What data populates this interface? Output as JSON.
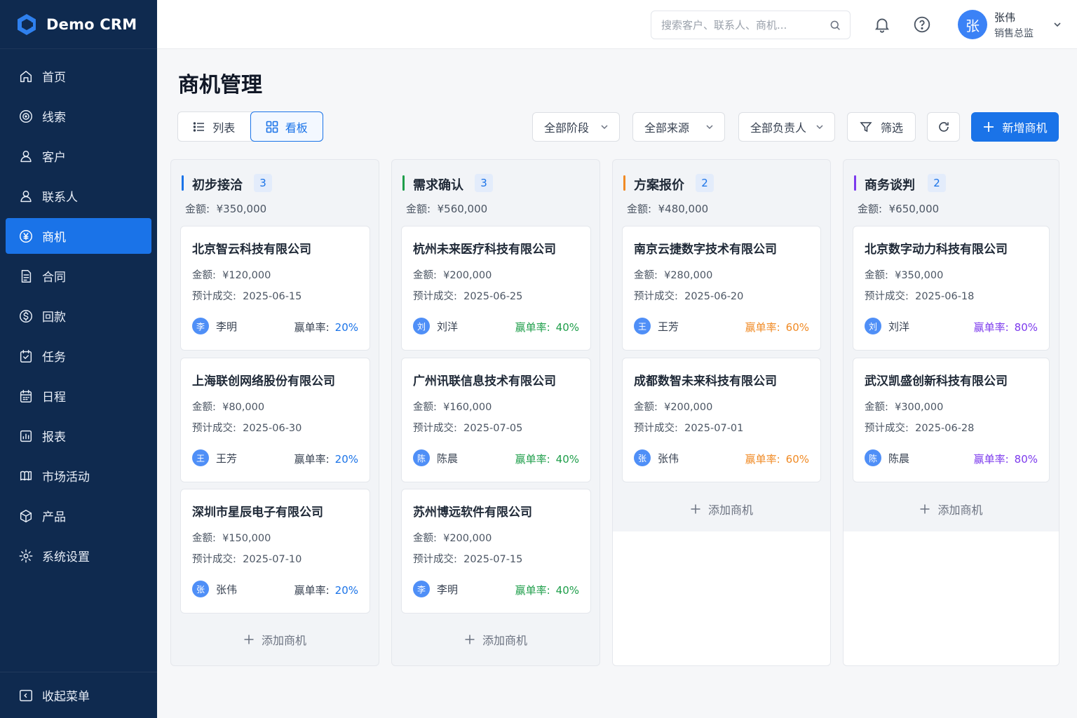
{
  "app": {
    "brand": "Demo CRM"
  },
  "sidebar": {
    "items": [
      {
        "label": "首页",
        "icon": "home-icon"
      },
      {
        "label": "线索",
        "icon": "lead-icon"
      },
      {
        "label": "客户",
        "icon": "customer-icon"
      },
      {
        "label": "联系人",
        "icon": "contact-icon"
      },
      {
        "label": "商机",
        "icon": "opportunity-icon",
        "active": true
      },
      {
        "label": "合同",
        "icon": "contract-icon"
      },
      {
        "label": "回款",
        "icon": "payment-icon"
      },
      {
        "label": "任务",
        "icon": "task-icon"
      },
      {
        "label": "日程",
        "icon": "calendar-icon"
      },
      {
        "label": "报表",
        "icon": "report-icon"
      },
      {
        "label": "市场活动",
        "icon": "campaign-icon"
      },
      {
        "label": "产品",
        "icon": "product-icon"
      },
      {
        "label": "系统设置",
        "icon": "settings-icon"
      }
    ],
    "collapse_label": "收起菜单"
  },
  "topbar": {
    "search_placeholder": "搜索客户、联系人、商机...",
    "user": {
      "avatar": "张",
      "name": "张伟",
      "role": "销售总监"
    }
  },
  "page": {
    "title": "商机管理",
    "view": {
      "list": "列表",
      "board": "看板",
      "active": "board"
    },
    "filters": {
      "stage": "全部阶段",
      "source": "全部来源",
      "owner": "全部负责人"
    },
    "filter_button": "筛选",
    "add_button": "新增商机"
  },
  "labels": {
    "amount": "金额:",
    "expected": "预计成交:",
    "win_rate": "赢单率:",
    "add_deal": "添加商机"
  },
  "colors": {
    "primary": "#1a73e8",
    "sidebar": "#0f2a4f",
    "stage1": "#1a73e8",
    "stage2": "#1e9e4a",
    "stage3": "#f08a24",
    "stage4": "#7c3aed"
  },
  "board": {
    "columns": [
      {
        "title": "初步接洽",
        "count": "3",
        "amount": "¥350,000",
        "color": "#1a73e8",
        "cards": [
          {
            "name": "北京智云科技有限公司",
            "amount": "¥120,000",
            "date": "2025-06-15",
            "owner_initial": "李",
            "owner": "李明",
            "rate": "20%"
          },
          {
            "name": "上海联创网络股份有限公司",
            "amount": "¥80,000",
            "date": "2025-06-30",
            "owner_initial": "王",
            "owner": "王芳",
            "rate": "20%"
          },
          {
            "name": "深圳市星辰电子有限公司",
            "amount": "¥150,000",
            "date": "2025-07-10",
            "owner_initial": "张",
            "owner": "张伟",
            "rate": "20%"
          }
        ]
      },
      {
        "title": "需求确认",
        "count": "3",
        "amount": "¥560,000",
        "color": "#1e9e4a",
        "cards": [
          {
            "name": "杭州未来医疗科技有限公司",
            "amount": "¥200,000",
            "date": "2025-06-25",
            "owner_initial": "刘",
            "owner": "刘洋",
            "rate": "40%"
          },
          {
            "name": "广州讯联信息技术有限公司",
            "amount": "¥160,000",
            "date": "2025-07-05",
            "owner_initial": "陈",
            "owner": "陈晨",
            "rate": "40%"
          },
          {
            "name": "苏州博远软件有限公司",
            "amount": "¥200,000",
            "date": "2025-07-15",
            "owner_initial": "李",
            "owner": "李明",
            "rate": "40%"
          }
        ]
      },
      {
        "title": "方案报价",
        "count": "2",
        "amount": "¥480,000",
        "color": "#f08a24",
        "cards": [
          {
            "name": "南京云捷数字技术有限公司",
            "amount": "¥280,000",
            "date": "2025-06-20",
            "owner_initial": "王",
            "owner": "王芳",
            "rate": "60%"
          },
          {
            "name": "成都数智未来科技有限公司",
            "amount": "¥200,000",
            "date": "2025-07-01",
            "owner_initial": "张",
            "owner": "张伟",
            "rate": "60%"
          }
        ]
      },
      {
        "title": "商务谈判",
        "count": "2",
        "amount": "¥650,000",
        "color": "#7c3aed",
        "cards": [
          {
            "name": "北京数字动力科技有限公司",
            "amount": "¥350,000",
            "date": "2025-06-18",
            "owner_initial": "刘",
            "owner": "刘洋",
            "rate": "80%"
          },
          {
            "name": "武汉凯盛创新科技有限公司",
            "amount": "¥300,000",
            "date": "2025-06-28",
            "owner_initial": "陈",
            "owner": "陈晨",
            "rate": "80%"
          }
        ]
      }
    ]
  }
}
